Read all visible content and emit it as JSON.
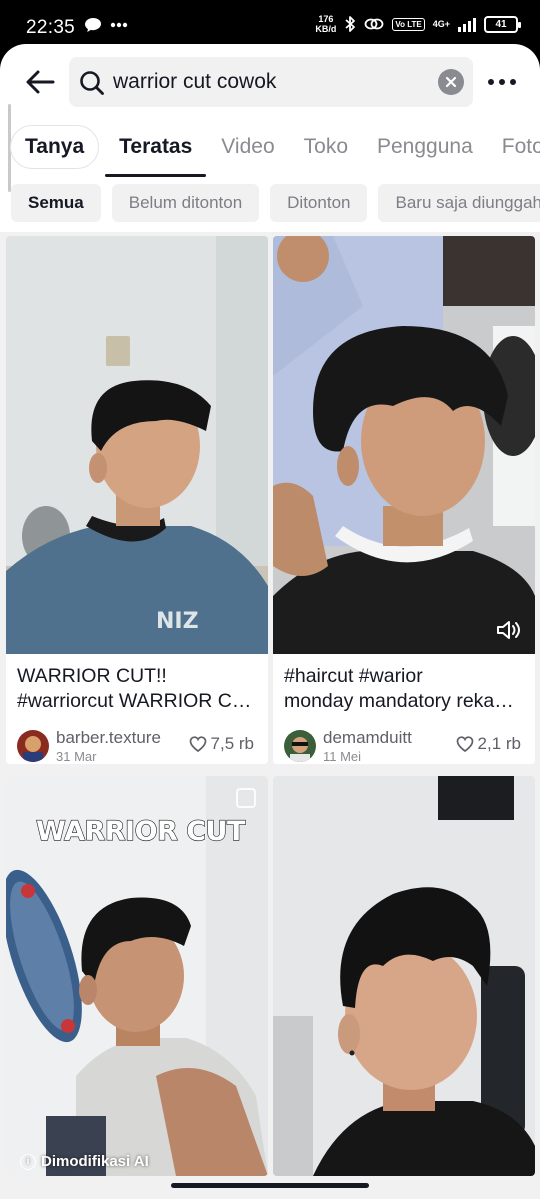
{
  "status_bar": {
    "time": "22:35",
    "net_speed_value": "176",
    "net_speed_unit": "KB/d",
    "network": "4G+",
    "volte": "Vo LTE",
    "battery": "41",
    "icons": [
      "chat-bubble-icon",
      "more-dots-icon",
      "bluetooth-icon",
      "link-icon",
      "signal-icon",
      "battery-icon"
    ]
  },
  "search": {
    "query": "warrior cut cowok",
    "icons": [
      "back-arrow-icon",
      "search-icon",
      "clear-icon",
      "more-icon"
    ]
  },
  "tabs": [
    {
      "label": "Tanya"
    },
    {
      "label": "Teratas"
    },
    {
      "label": "Video"
    },
    {
      "label": "Toko"
    },
    {
      "label": "Pengguna"
    },
    {
      "label": "Foto"
    }
  ],
  "active_tab": "Teratas",
  "filters": [
    {
      "label": "Semua"
    },
    {
      "label": "Belum ditonton"
    },
    {
      "label": "Ditonton"
    },
    {
      "label": "Baru saja diunggah"
    }
  ],
  "active_filter": "Semua",
  "results": [
    {
      "caption_line1": "WARRIOR CUT!!",
      "caption_line2": "#warriorcut WARRIOR CUT cowok",
      "username": "barber.texture",
      "date": "31 Mar",
      "likes": "7,5 rb",
      "thumb_text": "NIZ"
    },
    {
      "caption_line1": "#haircut #warior",
      "caption_line2": "monday mandatory rekap warrior cut",
      "username": "demamduitt",
      "date": "11 Mei",
      "likes": "2,1 rb"
    },
    {
      "overlay_title": "WARRIOR CUT",
      "badge": "Dimodifikasi AI"
    },
    {}
  ],
  "colors": {
    "text": "#161823",
    "muted": "#8a8b91",
    "chip_bg": "#f1f1f2",
    "grid_bg": "#f1f1f2"
  }
}
